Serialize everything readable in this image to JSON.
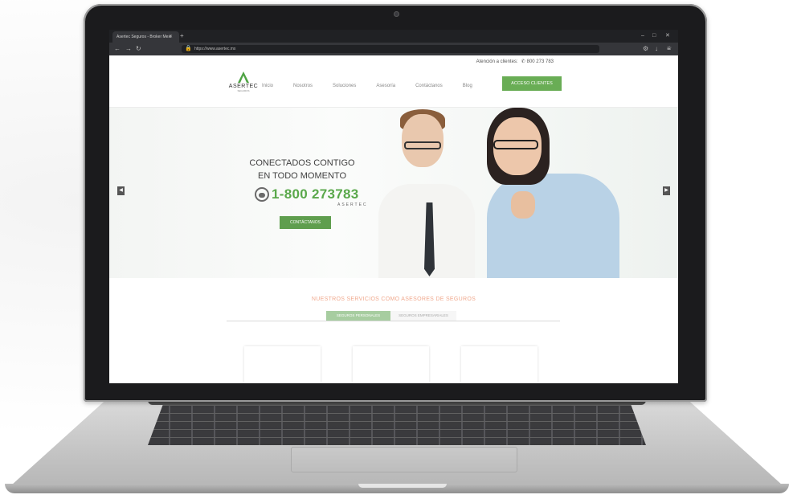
{
  "browser": {
    "tab_title": "Asertec Seguros - Broker Mexi",
    "tab_close": "✕",
    "new_tab": "+",
    "url": "https://www.asertec.mx",
    "window_controls": [
      "–",
      "□",
      "✕"
    ]
  },
  "topbar": {
    "text": "Atención a clientes:",
    "phone": "800 273 783"
  },
  "logo": {
    "name": "ASERTEC",
    "sub": "SEGUROS"
  },
  "menu": {
    "items": [
      "Inicio",
      "Nosotros",
      "Soluciones",
      "Asesoría",
      "Contáctanos",
      "Blog"
    ],
    "access_button": "ACCESO CLIENTES"
  },
  "hero": {
    "title_line1": "CONECTADOS CONTIGO",
    "title_line2": "EN TODO MOMENTO",
    "hotline": "1-800 273783",
    "hotline_brand": "ASERTEC",
    "cta": "CONTÁCTANOS",
    "prev_arrow": "◀",
    "next_arrow": "▶"
  },
  "services": {
    "title": "NUESTROS SERVICIOS COMO ASESORES DE SEGUROS",
    "tabs": [
      "SEGUROS PERSONALES",
      "SEGUROS EMPRESARIALES"
    ]
  },
  "colors": {
    "brand_green": "#69ad55",
    "accent_salmon": "#f0a98e"
  }
}
